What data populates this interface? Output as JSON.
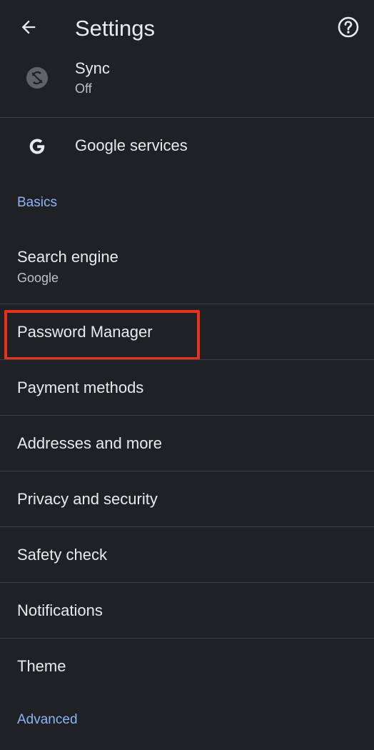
{
  "app_bar": {
    "title": "Settings",
    "back_icon": "arrow-back-icon",
    "help_icon": "help-icon"
  },
  "rows": {
    "sync": {
      "label": "Sync",
      "sublabel": "Off",
      "icon": "sync-off-icon"
    },
    "google_services": {
      "label": "Google services",
      "icon": "google-g-icon"
    },
    "search_engine": {
      "label": "Search engine",
      "sublabel": "Google"
    },
    "password_manager": {
      "label": "Password Manager"
    },
    "payment_methods": {
      "label": "Payment methods"
    },
    "addresses": {
      "label": "Addresses and more"
    },
    "privacy": {
      "label": "Privacy and security"
    },
    "safety_check": {
      "label": "Safety check"
    },
    "notifications": {
      "label": "Notifications"
    },
    "theme": {
      "label": "Theme"
    }
  },
  "sections": {
    "basics": "Basics",
    "advanced": "Advanced"
  },
  "colors": {
    "background": "#202124",
    "text_primary": "#e8eaed",
    "text_secondary": "#bdc1c6",
    "section_header": "#8ab4f8",
    "divider": "#3c4043",
    "highlight_box": "#e8321d"
  }
}
